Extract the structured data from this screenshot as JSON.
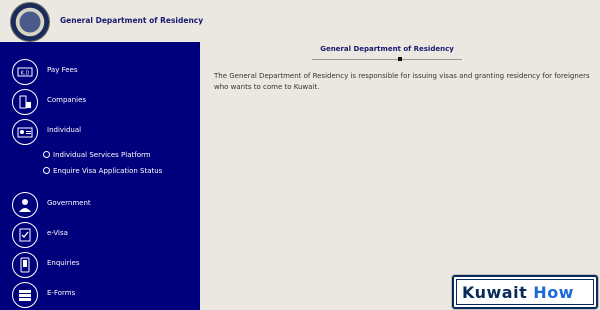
{
  "header": {
    "logo_icon": "residency-emblem",
    "title": "General Department of Residency"
  },
  "sidebar": {
    "items": [
      {
        "label": "Pay Fees",
        "icon": "kd-currency-icon"
      },
      {
        "label": "Companies",
        "icon": "building-icon"
      },
      {
        "label": "Individual",
        "icon": "id-card-icon"
      },
      {
        "label": "Government",
        "icon": "government-person-icon"
      },
      {
        "label": "e-Visa",
        "icon": "document-check-icon"
      },
      {
        "label": "Enquiries",
        "icon": "phone-icon"
      },
      {
        "label": "E-Forms",
        "icon": "form-stack-icon"
      }
    ],
    "individual_subitems": [
      {
        "label": "Individual Services Platform"
      },
      {
        "label": "Enquire Visa Application Status"
      }
    ]
  },
  "main": {
    "title": "General Department of Residency",
    "description": "The General Department of Residency is responsible for issuing visas and granting residency for foreigners who wants to come to Kuwait."
  },
  "watermark": {
    "part1": "Kuwait",
    "part2": "How"
  },
  "colors": {
    "sidebar_bg": "#00007c",
    "page_bg": "#ebe8e1",
    "title_color": "#1a1a6e"
  }
}
